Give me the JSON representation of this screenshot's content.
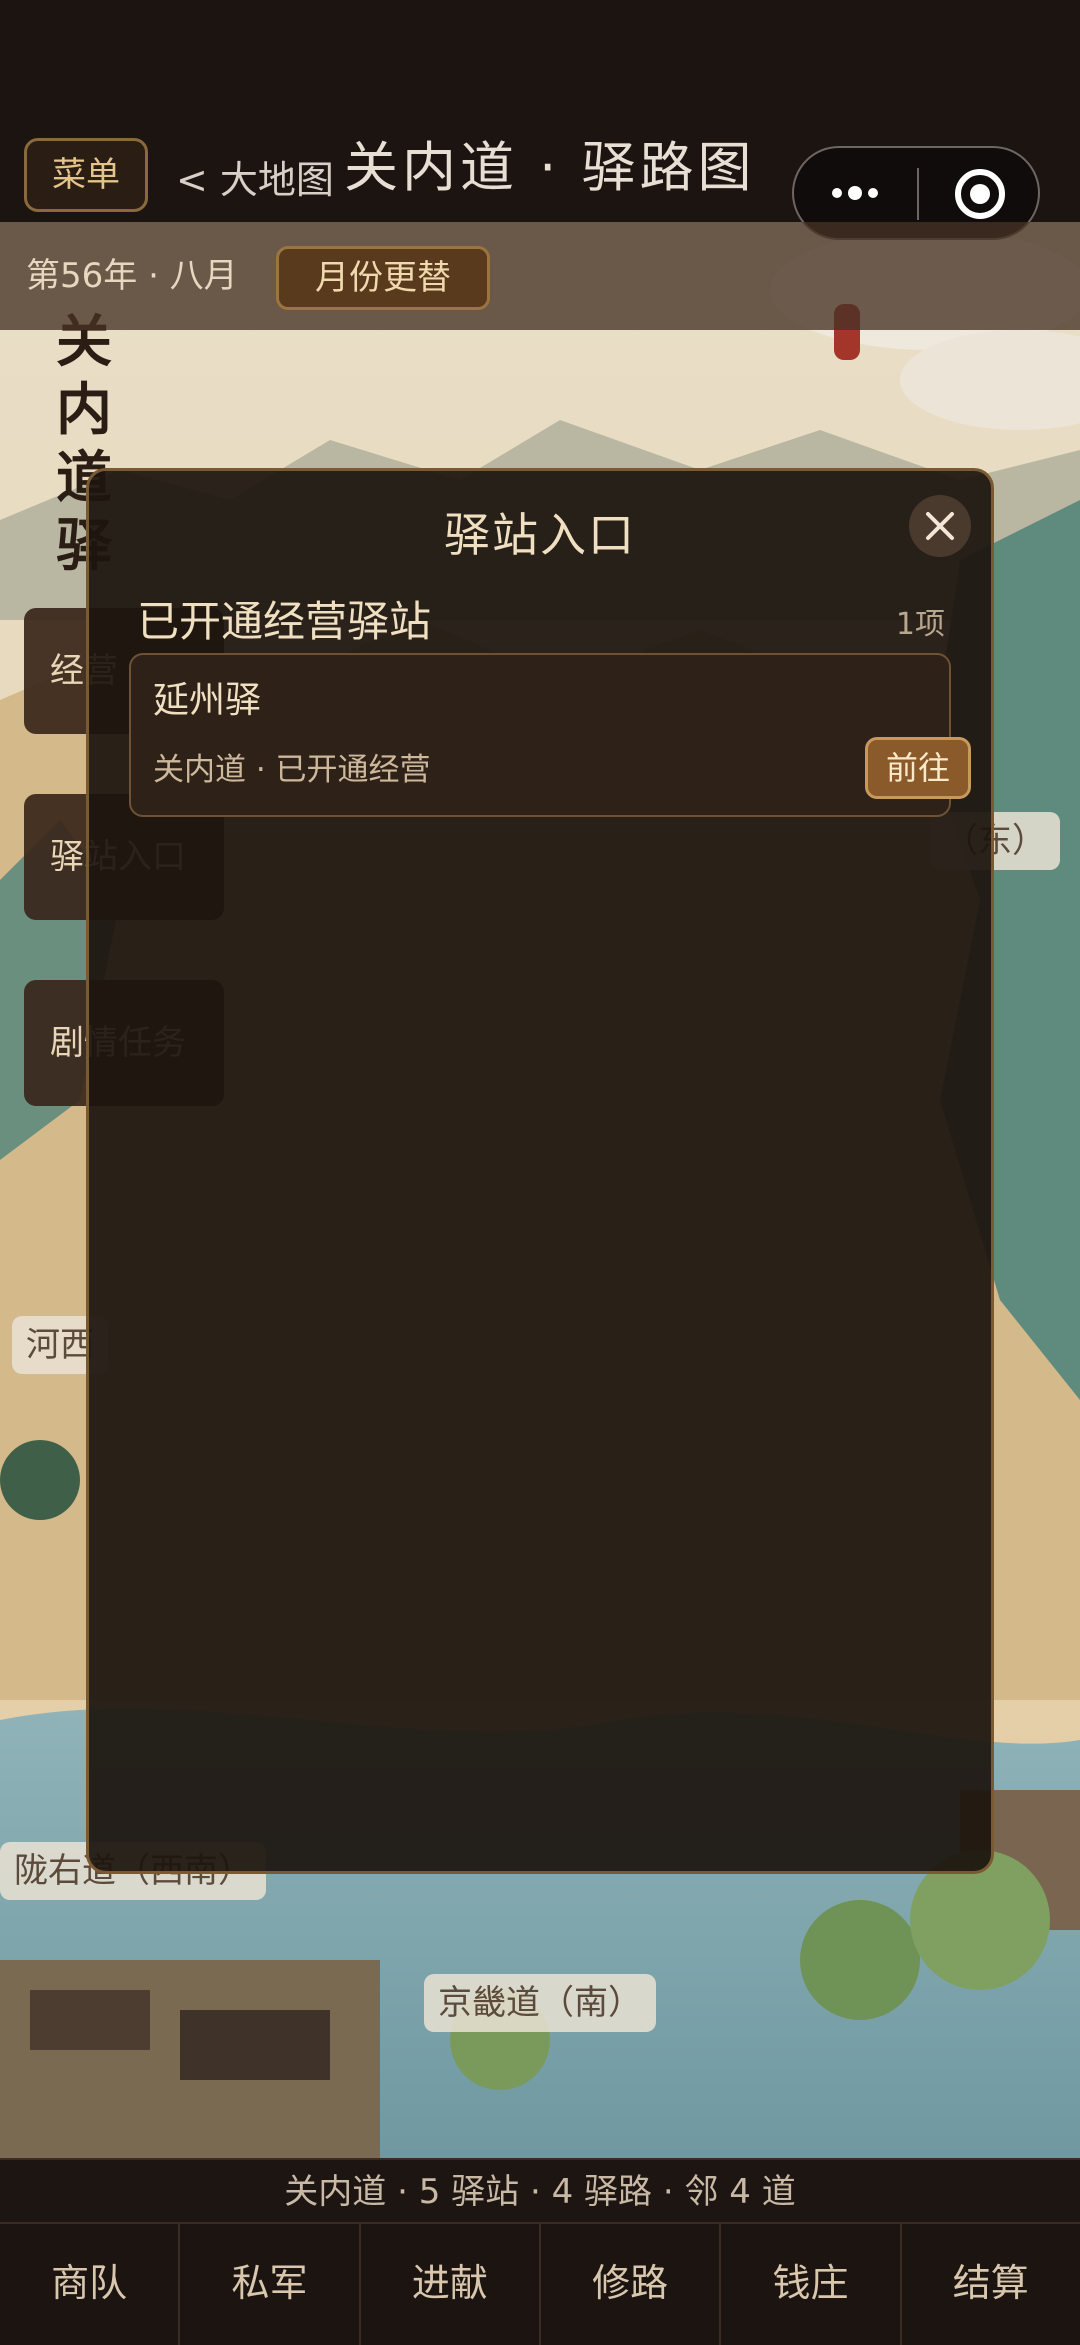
{
  "header": {
    "menu_label": "菜单",
    "back_label": "< 大地图",
    "title": "关内道 · 驿路图"
  },
  "capsule": {
    "more_icon": "more-dots-icon",
    "target_icon": "target-icon"
  },
  "subbar": {
    "year_month": "第56年 · 八月",
    "month_button": "月份更替"
  },
  "map": {
    "vertical_title": "关内道驿",
    "side_buttons": [
      "经营",
      "驿站入口",
      "剧情任务"
    ],
    "labels": {
      "east": "（东）",
      "hexi": "河西",
      "longyou": "陇右道（西南）",
      "jingji": "京畿道（南）"
    }
  },
  "modal": {
    "title": "驿站入口",
    "section_title": "已开通经营驿站",
    "section_count": "1项",
    "stations": [
      {
        "name": "延州驿",
        "subtitle": "关内道 · 已开通经营",
        "action": "前往"
      }
    ]
  },
  "info_strip": "关内道 · 5 驿站 · 4 驿路 · 邻 4 道",
  "tabs": [
    "商队",
    "私军",
    "进献",
    "修路",
    "钱庄",
    "结算"
  ],
  "colors": {
    "accent_gold": "#c79a5c",
    "panel_bg": "#1c140e",
    "text_light": "#f0dfc0"
  }
}
